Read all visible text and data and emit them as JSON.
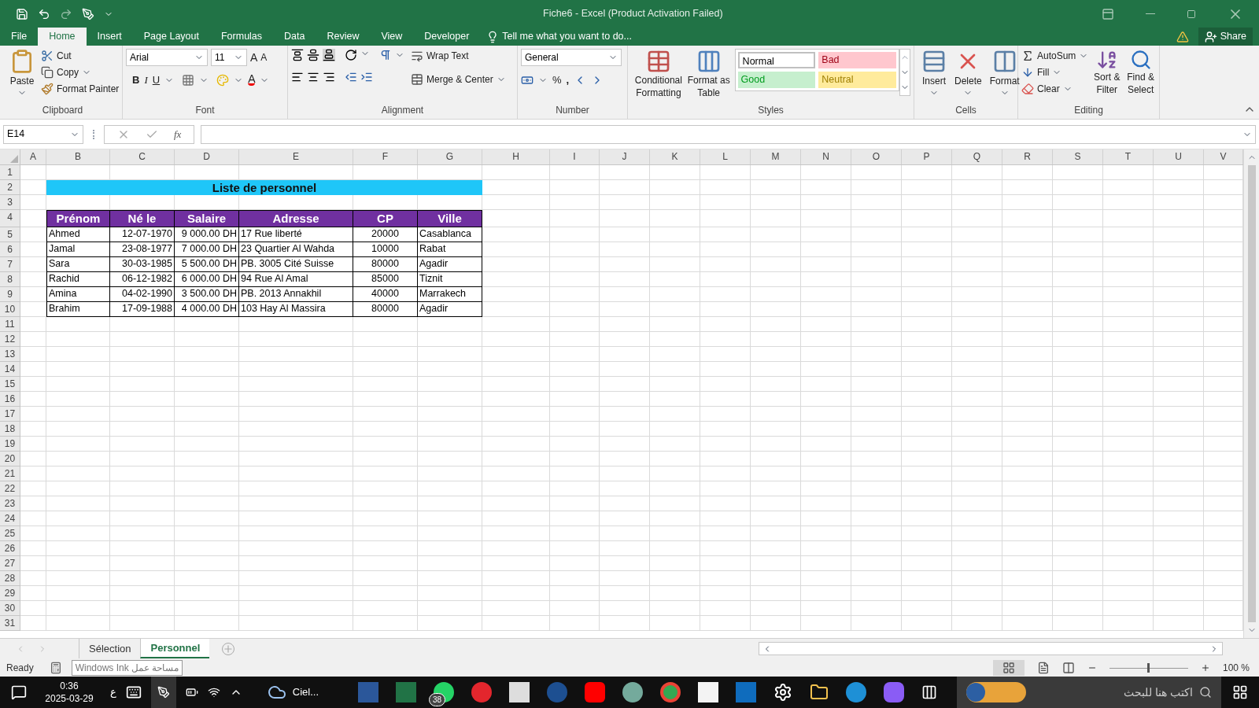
{
  "window": {
    "title": "Fiche6 - Excel (Product Activation Failed)"
  },
  "menu_tabs": [
    {
      "label": "File",
      "selected": false
    },
    {
      "label": "Home",
      "selected": true
    },
    {
      "label": "Insert",
      "selected": false
    },
    {
      "label": "Page Layout",
      "selected": false
    },
    {
      "label": "Formulas",
      "selected": false
    },
    {
      "label": "Data",
      "selected": false
    },
    {
      "label": "Review",
      "selected": false
    },
    {
      "label": "View",
      "selected": false
    },
    {
      "label": "Developer",
      "selected": false
    }
  ],
  "tell_me": "Tell me what you want to do...",
  "share": "Share",
  "ribbon": {
    "clipboard": {
      "label": "Clipboard",
      "paste": "Paste",
      "cut": "Cut",
      "copy": "Copy",
      "format_painter": "Format Painter"
    },
    "font": {
      "label": "Font",
      "name": "Arial",
      "size": "11",
      "grow": "A",
      "shrink": "A",
      "bold": "B",
      "italic": "I",
      "underline": "U",
      "font_color_letter": "A"
    },
    "alignment": {
      "label": "Alignment",
      "wrap_text": "Wrap Text",
      "merge": "Merge & Center"
    },
    "number": {
      "label": "Number",
      "format": "General",
      "percent": "%",
      "comma": ","
    },
    "styles": {
      "label": "Styles",
      "conditional": "Conditional Formatting",
      "format_table": "Format as Table",
      "cell_styles": [
        {
          "label": "Normal",
          "color": "#ffffff"
        },
        {
          "label": "Bad",
          "color": "#ffc7ce"
        },
        {
          "label": "Good",
          "color": "#c6efce"
        },
        {
          "label": "Neutral",
          "color": "#ffeb9c"
        }
      ]
    },
    "cells": {
      "label": "Cells",
      "insert": "Insert",
      "delete": "Delete",
      "format": "Format"
    },
    "editing": {
      "label": "Editing",
      "autosum": "AutoSum",
      "fill": "Fill",
      "clear": "Clear",
      "sort": "Sort & Filter",
      "find": "Find & Select"
    }
  },
  "formula_bar": {
    "name_box": "E14",
    "fx": "fx"
  },
  "sheet": {
    "columns": [
      "A",
      "B",
      "C",
      "D",
      "E",
      "F",
      "G",
      "H",
      "I",
      "J",
      "K",
      "L",
      "M",
      "N",
      "O",
      "P",
      "Q",
      "R",
      "S",
      "T",
      "U",
      "V"
    ],
    "rows": [
      "1",
      "2",
      "3",
      "4",
      "5",
      "6",
      "7",
      "8",
      "9",
      "10",
      "11",
      "12",
      "13",
      "14",
      "15",
      "16",
      "17",
      "18",
      "19",
      "20",
      "21",
      "22",
      "23",
      "24",
      "25",
      "26",
      "27",
      "28",
      "29",
      "30",
      "31"
    ],
    "title": "Liste de personnel",
    "headers": [
      "Prénom",
      "Né le",
      "Salaire",
      "Adresse",
      "CP",
      "Ville"
    ],
    "data": [
      [
        "Ahmed",
        "12-07-1970",
        "9 000.00 DH",
        "17 Rue liberté",
        "20000",
        "Casablanca"
      ],
      [
        "Jamal",
        "23-08-1977",
        "7 000.00 DH",
        "23 Quartier Al Wahda",
        "10000",
        "Rabat"
      ],
      [
        "Sara",
        "30-03-1985",
        "5 500.00 DH",
        "PB. 3005 Cité Suisse",
        "80000",
        "Agadir"
      ],
      [
        "Rachid",
        "06-12-1982",
        "6 000.00 DH",
        "94 Rue Al Amal",
        "85000",
        "Tiznit"
      ],
      [
        "Amina",
        "04-02-1990",
        "3 500.00 DH",
        "PB. 2013 Annakhil",
        "40000",
        "Marrakech"
      ],
      [
        "Brahim",
        "17-09-1988",
        "4 000.00 DH",
        "103 Hay Al Massira",
        "80000",
        "Agadir"
      ]
    ]
  },
  "sheet_tabs": [
    {
      "label": "Sélection",
      "selected": false
    },
    {
      "label": "Personnel",
      "selected": true
    }
  ],
  "status_bar": {
    "status": "Ready",
    "tooltip": "مساحة عمل Windows Ink",
    "zoom": "100 %",
    "zoom_slider": {
      "level": 0.5
    }
  },
  "taskbar": {
    "time": "0:36",
    "date": "2025-03-29",
    "language": "ع",
    "weather": "Ciel...",
    "badge": "38",
    "search": {
      "placeholder": "اكتب هنا للبحث"
    }
  }
}
